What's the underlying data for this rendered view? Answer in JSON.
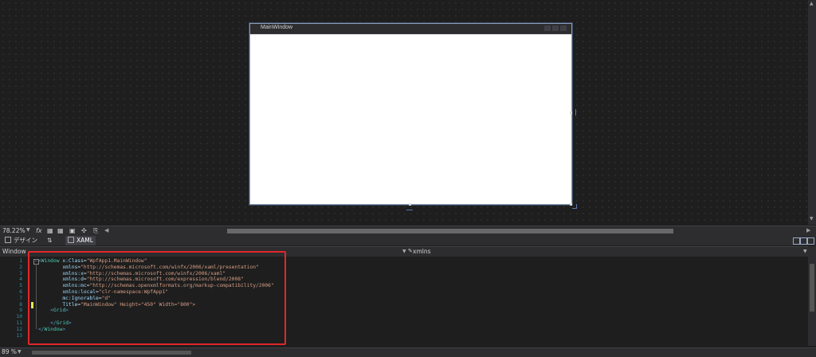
{
  "designer": {
    "preview_title": "MainWindow"
  },
  "zoom_bar": {
    "zoom_value": "78.22%",
    "fx_label": "fx"
  },
  "tabs": {
    "design_label": "デザイン",
    "swap_label": "⇅",
    "xaml_label": "XAML"
  },
  "nav_bar": {
    "left_label": "Window",
    "right_label": "xmlns"
  },
  "editor": {
    "line_numbers": [
      "1",
      "2",
      "3",
      "4",
      "5",
      "6",
      "7",
      "8",
      "9",
      "10",
      "11",
      "12",
      "13"
    ],
    "lines": [
      [
        "<",
        "Window",
        " x:Class",
        "=",
        "\"WpfApp1.MainWindow\""
      ],
      [
        "        ",
        "",
        "xmlns",
        "=",
        "\"http://schemas.microsoft.com/winfx/2006/xaml/presentation\""
      ],
      [
        "        ",
        "",
        "xmlns:x",
        "=",
        "\"http://schemas.microsoft.com/winfx/2006/xaml\""
      ],
      [
        "        ",
        "",
        "xmlns:d",
        "=",
        "\"http://schemas.microsoft.com/expression/blend/2008\""
      ],
      [
        "        ",
        "",
        "xmlns:mc",
        "=",
        "\"http://schemas.openxmlformats.org/markup-compatibility/2006\""
      ],
      [
        "        ",
        "",
        "xmlns:local",
        "=",
        "\"clr-namespace:WpfApp1\""
      ],
      [
        "        ",
        "",
        "mc:Ignorable",
        "=",
        "\"d\""
      ],
      [
        "        ",
        "",
        "Title",
        "=",
        "\"MainWindow\" Height=\"450\" Width=\"800\">"
      ],
      [
        "    <",
        "Grid",
        "",
        "",
        ">"
      ],
      [
        "",
        "",
        "",
        "",
        ""
      ],
      [
        "    </",
        "Grid",
        "",
        "",
        ">"
      ],
      [
        "</",
        "Window",
        "",
        "",
        ">"
      ],
      [
        "",
        "",
        "",
        "",
        ""
      ]
    ]
  },
  "status_bar": {
    "zoom_value": "89 %"
  }
}
